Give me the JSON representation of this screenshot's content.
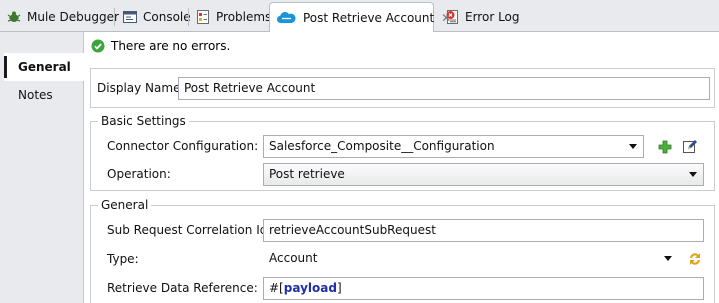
{
  "tabs": [
    {
      "label": "Mule Debugger",
      "icon": "bug-icon"
    },
    {
      "label": "Console",
      "icon": "console-icon"
    },
    {
      "label": "Problems",
      "icon": "problems-icon"
    },
    {
      "label": "Post Retrieve Account",
      "icon": "salesforce-cloud-icon",
      "active": true,
      "close": "✕"
    },
    {
      "label": "Error Log",
      "icon": "error-log-icon"
    }
  ],
  "nav": {
    "items": [
      {
        "label": "General",
        "selected": true
      },
      {
        "label": "Notes",
        "selected": false
      }
    ]
  },
  "status": {
    "text": "There are no errors."
  },
  "display_name": {
    "label": "Display Name:",
    "value": "Post Retrieve Account"
  },
  "basic_settings": {
    "title": "Basic Settings",
    "connector": {
      "label": "Connector Configuration:",
      "value": "Salesforce_Composite__Configuration"
    },
    "operation": {
      "label": "Operation:",
      "value": "Post retrieve"
    }
  },
  "general": {
    "title": "General",
    "sub_request": {
      "label": "Sub Request Correlation Id:",
      "value": "retrieveAccountSubRequest"
    },
    "type": {
      "label": "Type:",
      "value": "Account"
    },
    "data_ref": {
      "label": "Retrieve Data Reference:",
      "prefix": "#[",
      "keyword": "payload",
      "suffix": "]"
    }
  },
  "colors": {
    "accent_green": "#3aa63a",
    "expression_keyword": "#1f2fa8",
    "tab_bar": "#e8eaee"
  }
}
